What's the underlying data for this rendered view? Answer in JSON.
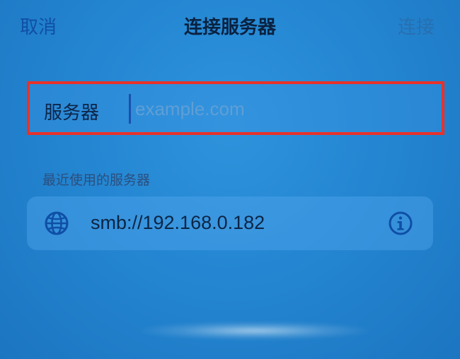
{
  "nav": {
    "cancel_label": "取消",
    "title": "连接服务器",
    "connect_label": "连接"
  },
  "server_field": {
    "label": "服务器",
    "value": "",
    "placeholder": "example.com"
  },
  "recent": {
    "header": "最近使用的服务器",
    "items": [
      {
        "address": "smb://192.168.0.182",
        "icon": "globe-icon",
        "action_icon": "info-icon"
      }
    ]
  },
  "colors": {
    "accent": "#0f4fa6",
    "highlight_border": "#e8312a",
    "background": "#2486d2"
  }
}
